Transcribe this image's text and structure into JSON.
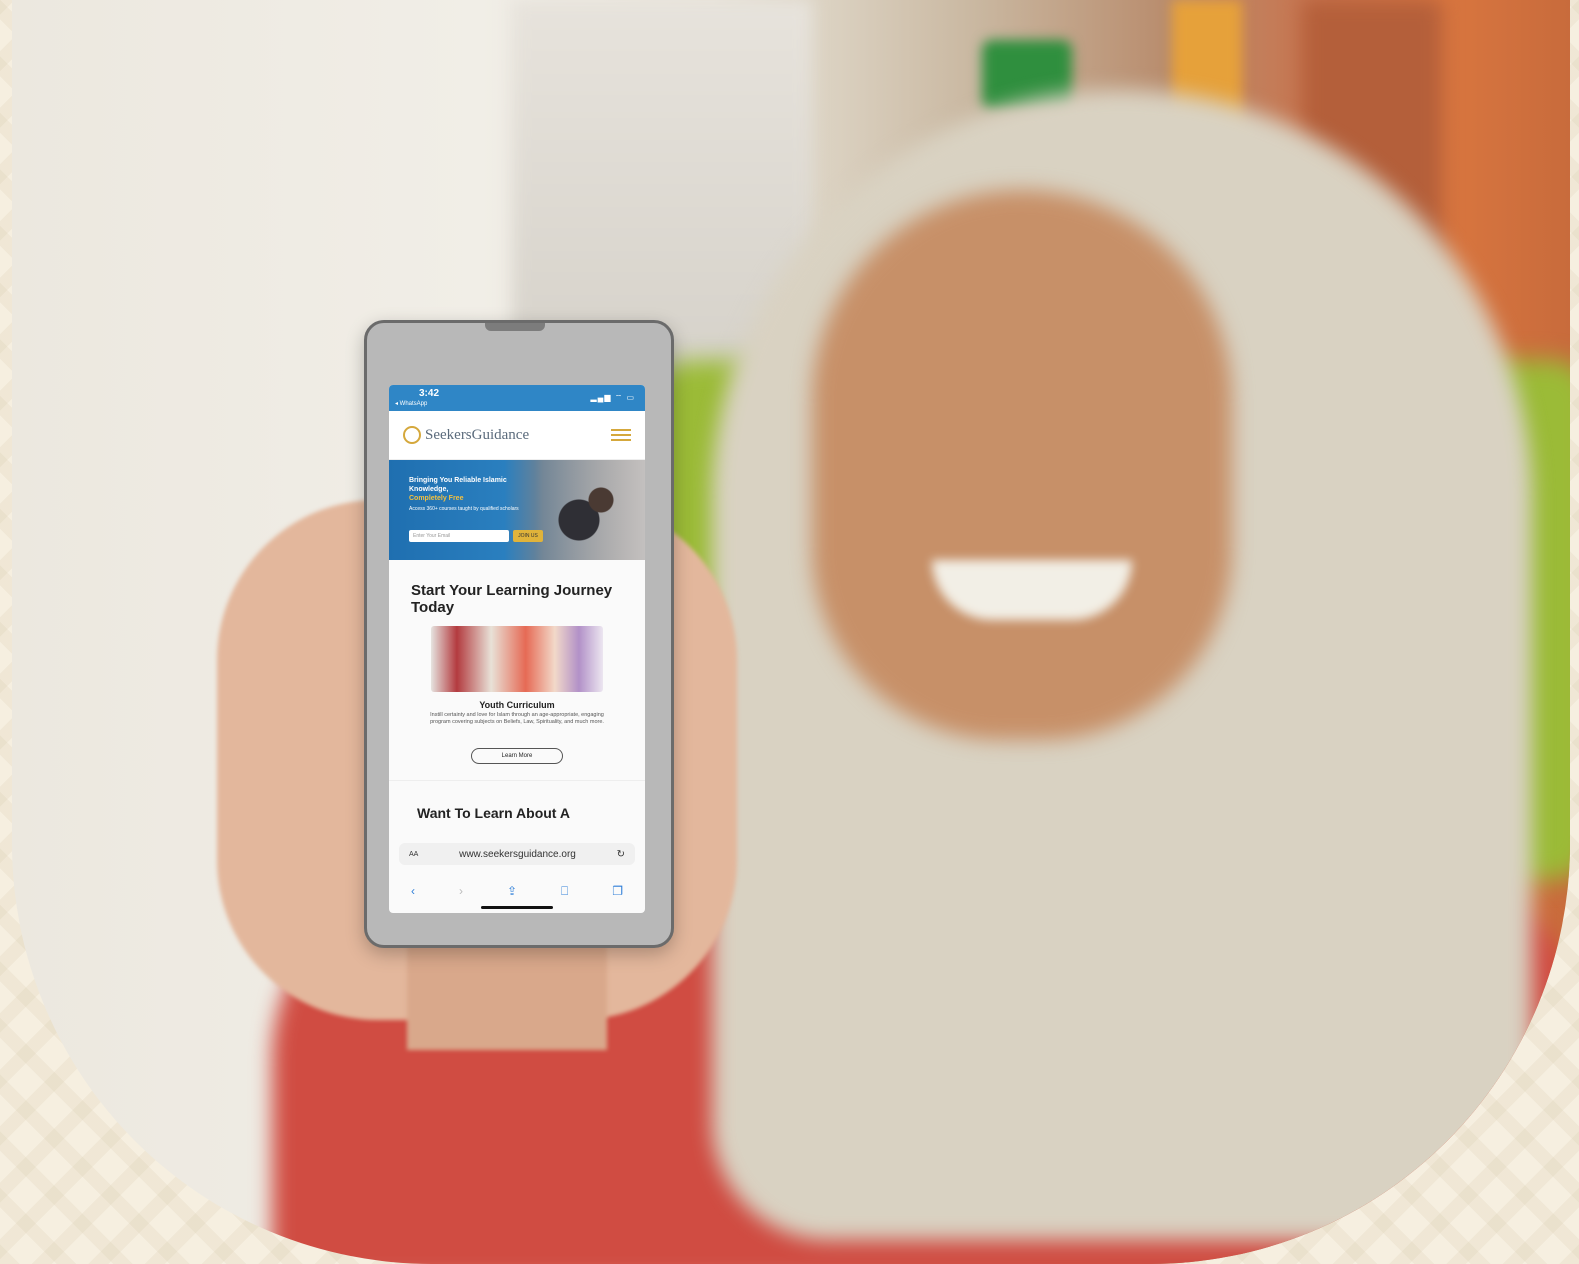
{
  "scene": {
    "description_colors": {
      "background": "#f6efe0",
      "sofa": "#9bbb37",
      "shirt": "#d04c42",
      "hijab": "#d9d2c2",
      "accent_gold": "#d5a83c",
      "status_blue": "#2f86c6"
    }
  },
  "phone": {
    "status": {
      "time": "3:42",
      "back_app": "◂ WhatsApp",
      "indicators": "▂▄▆ ⌔ ▭"
    },
    "site": {
      "logo_text": "SeekersGuidance",
      "menu_icon": "hamburger-icon"
    },
    "hero": {
      "headline_1": "Bringing You Reliable Islamic Knowledge,",
      "headline_2": "Completely Free",
      "sub": "Access 360+ courses taught by qualified scholars",
      "email_placeholder": "Enter Your Email",
      "join_label": "JOIN US"
    },
    "section_title": "Start Your Learning Journey Today",
    "card": {
      "title": "Youth Curriculum",
      "desc": "Instill certainty and love for Islam through an age-appropriate, engaging program covering subjects on Beliefs, Law, Spirituality, and much more."
    },
    "learn_more": "Learn More",
    "next_title": "Want To Learn About A",
    "browser": {
      "aa": "AA",
      "url": "www.seekersguidance.org",
      "reload": "↻",
      "back": "‹",
      "forward": "›",
      "share": "⇪",
      "bookmarks": "⎕",
      "tabs": "❐"
    }
  }
}
